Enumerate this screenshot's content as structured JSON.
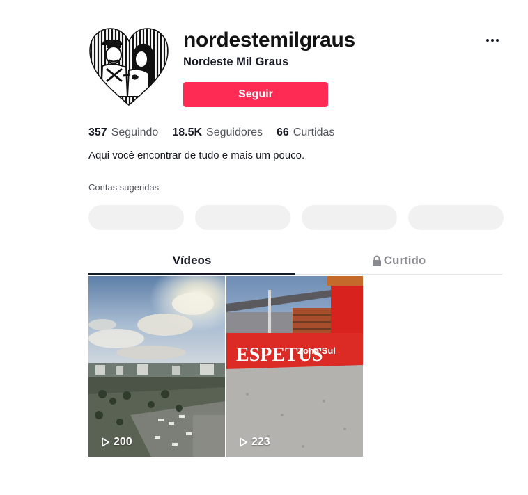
{
  "profile": {
    "username": "nordestemilgraus",
    "nickname": "Nordeste Mil Graus",
    "follow_label": "Seguir",
    "avatar_icon": "heart-couple-logo-icon",
    "bio": "Aqui você encontrar de tudo e mais um pouco."
  },
  "stats": [
    {
      "value": "357",
      "label": "Seguindo"
    },
    {
      "value": "18.5K",
      "label": "Seguidores"
    },
    {
      "value": "66",
      "label": "Curtidas"
    }
  ],
  "suggested": {
    "title": "Contas sugeridas",
    "count": 4
  },
  "tabs": [
    {
      "label": "Vídeos",
      "active": true
    },
    {
      "label": "Curtido",
      "active": false,
      "icon": "lock-icon"
    }
  ],
  "videos": [
    {
      "views": "200",
      "scene": "city-skyline-sunset"
    },
    {
      "views": "223",
      "scene": "espetus-zona-sul-storefront",
      "sign_text": "ESPETUS",
      "sign_sub": "Zona Sul"
    }
  ],
  "colors": {
    "accent": "#fe2c55",
    "text": "#161823",
    "pill": "#f1f1f2"
  }
}
